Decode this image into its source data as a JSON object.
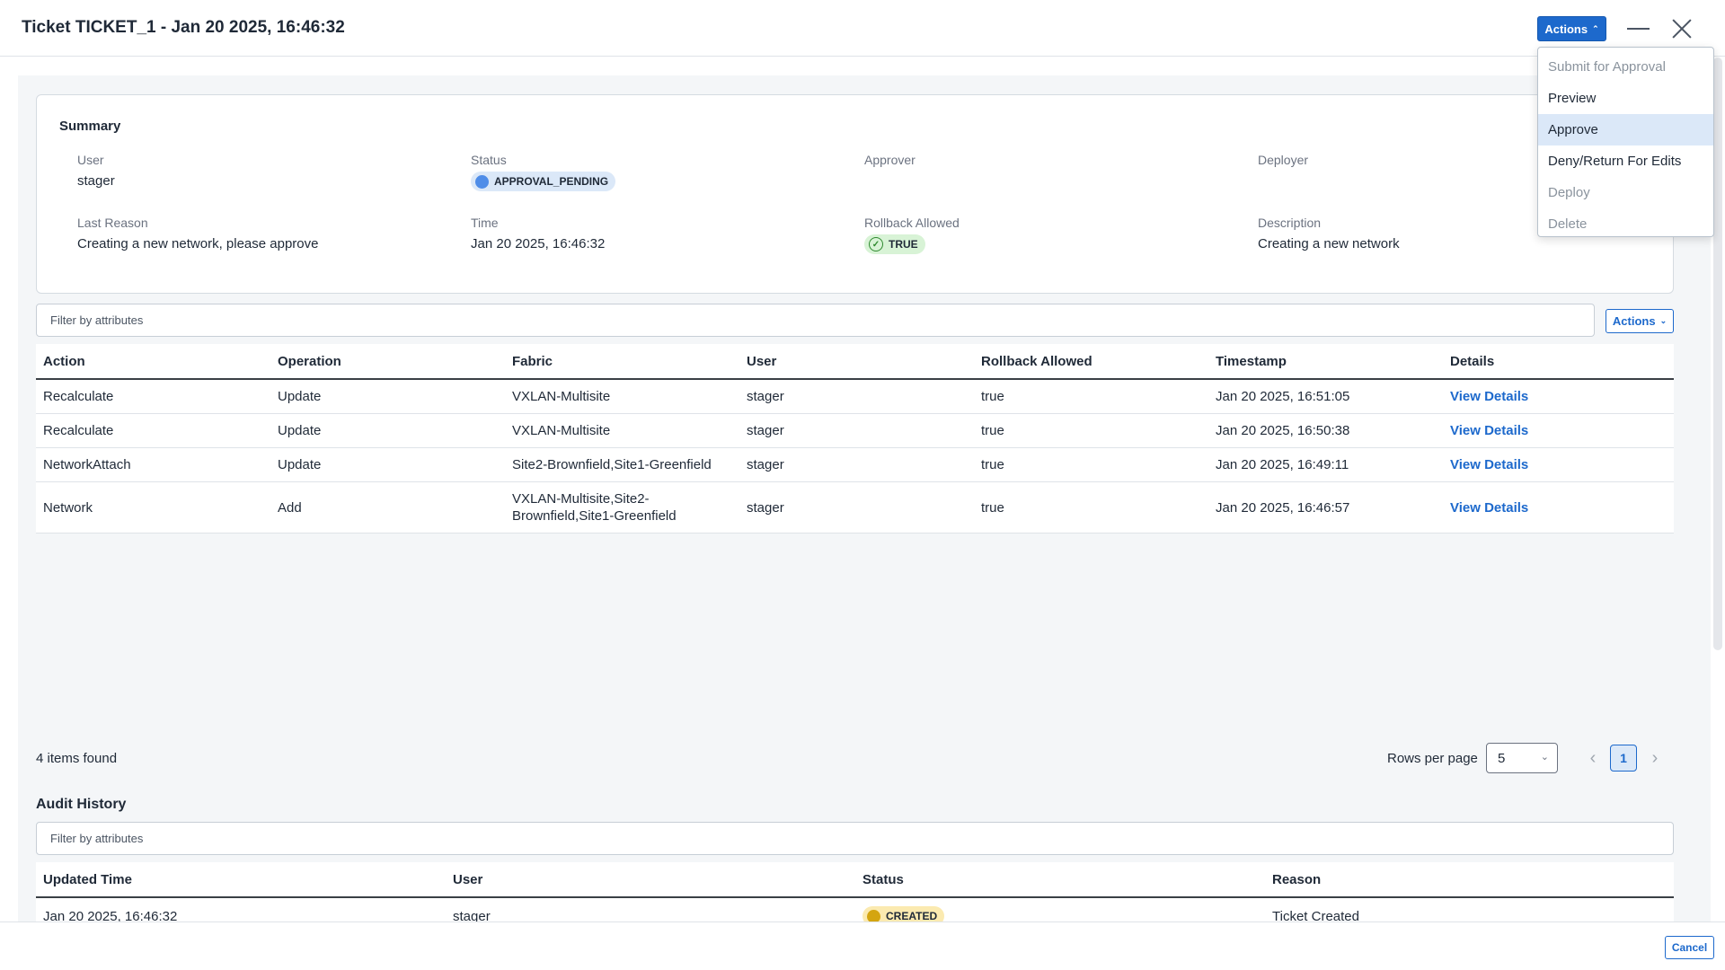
{
  "header": {
    "title": "Ticket TICKET_1 - Jan 20 2025, 16:46:32",
    "actions_label": "Actions"
  },
  "actions_menu": {
    "items": [
      {
        "label": "Submit for Approval",
        "disabled": true
      },
      {
        "label": "Preview",
        "disabled": false
      },
      {
        "label": "Approve",
        "disabled": false,
        "highlighted": true
      },
      {
        "label": "Deny/Return For Edits",
        "disabled": false
      },
      {
        "label": "Deploy",
        "disabled": true
      },
      {
        "label": "Delete",
        "disabled": true
      }
    ]
  },
  "summary": {
    "title": "Summary",
    "user_label": "User",
    "user": "stager",
    "status_label": "Status",
    "status": "APPROVAL_PENDING",
    "approver_label": "Approver",
    "approver": "",
    "deployer_label": "Deployer",
    "deployer": "",
    "last_reason_label": "Last Reason",
    "last_reason": "Creating a new network, please approve",
    "time_label": "Time",
    "time": "Jan 20 2025, 16:46:32",
    "rollback_label": "Rollback Allowed",
    "rollback": "TRUE",
    "description_label": "Description",
    "description": "Creating a new network"
  },
  "changes": {
    "filter_placeholder": "Filter by attributes",
    "actions_label": "Actions",
    "columns": [
      "Action",
      "Operation",
      "Fabric",
      "User",
      "Rollback Allowed",
      "Timestamp",
      "Details"
    ],
    "rows": [
      {
        "action": "Recalculate",
        "operation": "Update",
        "fabric": "VXLAN-Multisite",
        "user": "stager",
        "rollback": "true",
        "timestamp": "Jan 20 2025, 16:51:05",
        "details": "View Details"
      },
      {
        "action": "Recalculate",
        "operation": "Update",
        "fabric": "VXLAN-Multisite",
        "user": "stager",
        "rollback": "true",
        "timestamp": "Jan 20 2025, 16:50:38",
        "details": "View Details"
      },
      {
        "action": "NetworkAttach",
        "operation": "Update",
        "fabric": "Site2-Brownfield,Site1-Greenfield",
        "user": "stager",
        "rollback": "true",
        "timestamp": "Jan 20 2025, 16:49:11",
        "details": "View Details"
      },
      {
        "action": "Network",
        "operation": "Add",
        "fabric": "VXLAN-Multisite,Site2-Brownfield,Site1-Greenfield",
        "fabric_line1": "VXLAN-Multisite,Site2-",
        "fabric_line2": "Brownfield,Site1-Greenfield",
        "user": "stager",
        "rollback": "true",
        "timestamp": "Jan 20 2025, 16:46:57",
        "details": "View Details"
      }
    ],
    "items_found": "4 items found",
    "rows_per_page_label": "Rows per page",
    "rows_per_page": "5",
    "current_page": "1",
    "prev_glyph": "‹",
    "next_glyph": "›"
  },
  "audit": {
    "title": "Audit History",
    "filter_placeholder": "Filter by attributes",
    "columns": [
      "Updated Time",
      "User",
      "Status",
      "Reason"
    ],
    "rows": [
      {
        "updated_time": "Jan 20 2025, 16:46:32",
        "user": "stager",
        "status": "CREATED",
        "reason": "Ticket Created"
      }
    ]
  },
  "footer": {
    "cancel_label": "Cancel"
  },
  "colors": {
    "primary": "#1d69cc",
    "pending_dot": "#4f8de8",
    "true_badge_bg": "#d8f3d6",
    "created_dot": "#d4a510"
  },
  "icons": {
    "minimize": "minimize-icon",
    "close": "close-icon",
    "chevron": "chevron-down-icon",
    "check": "check-circle-icon"
  }
}
